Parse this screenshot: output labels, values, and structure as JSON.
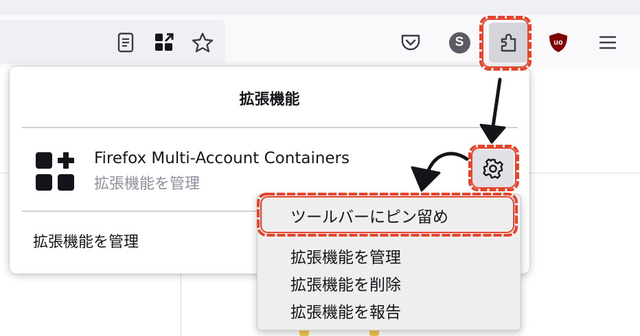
{
  "panel": {
    "title": "拡張機能",
    "extension": {
      "name": "Firefox Multi-Account Containers",
      "subtitle": "拡張機能を管理"
    },
    "manage_link": "拡張機能を管理"
  },
  "context_menu": {
    "items": [
      "ツールバーにピン留め",
      "拡張機能を管理",
      "拡張機能を削除",
      "拡張機能を報告"
    ]
  },
  "toolbar": {
    "icons": [
      "reader-view-icon",
      "extension-grid-icon",
      "bookmark-star-icon",
      "pocket-icon",
      "account-avatar-icon",
      "extensions-puzzle-icon",
      "ublock-origin-icon",
      "hamburger-menu-icon"
    ],
    "avatar_letter": "S",
    "ublock_label": "uo"
  },
  "colors": {
    "annotation_red": "#e8432a",
    "ublock_red": "#800000",
    "panel_bg": "#ffffff",
    "menu_bg": "#eeeeee"
  }
}
